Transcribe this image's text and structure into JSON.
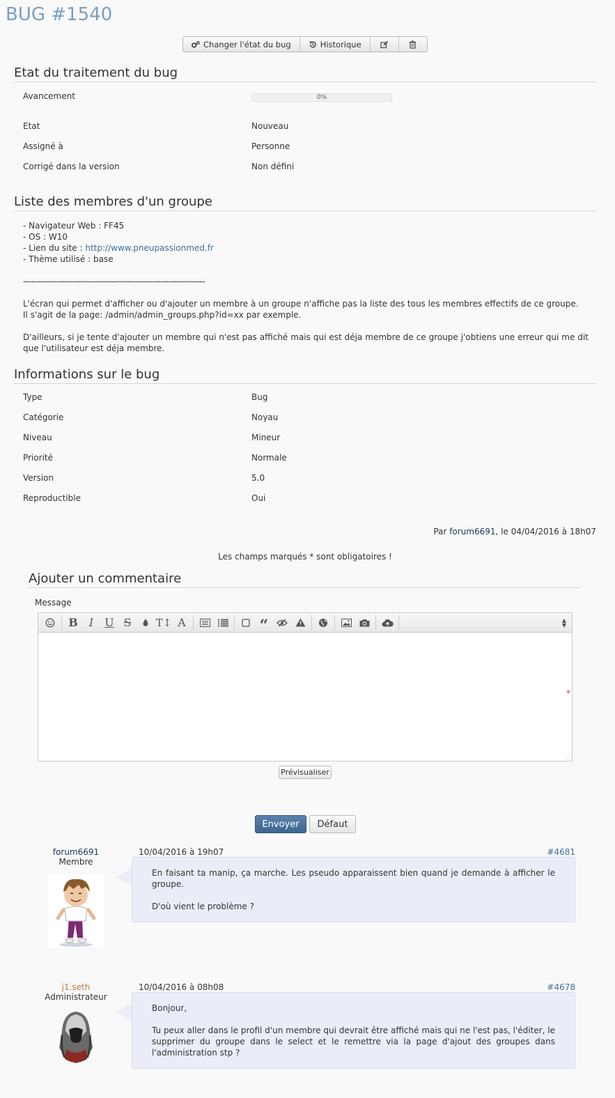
{
  "page": {
    "title": "BUG #1540"
  },
  "toolbar": {
    "change_state": "Changer l'état du bug",
    "history": "Historique"
  },
  "status_section": {
    "title": "Etat du traitement du bug",
    "progress_label": "Avancement",
    "progress_text": "0%",
    "progress_value": 0,
    "rows": [
      {
        "label": "Etat",
        "value": "Nouveau"
      },
      {
        "label": "Assigné à",
        "value": "Personne"
      },
      {
        "label": "Corrigé dans la version",
        "value": "Non défini"
      }
    ]
  },
  "description": {
    "title": "Liste des membres d'un groupe",
    "browser": "- Navigateur Web : FF45",
    "os": "- OS : W10",
    "site_prefix": "- Lien du site : ",
    "site_link": "http://www.pneupassionmed.fr",
    "theme": "- Thème utilisé : base",
    "separator": "----------------------------------------------------------------------",
    "para1_line1": "L'écran qui permet d'afficher ou d'ajouter un membre à un groupe n'affiche pas la liste des tous les membres effectifs de ce groupe.",
    "para1_line2": "Il s'agit de la page: /admin/admin_groups.php?id=xx par exemple.",
    "para2": "D'ailleurs, si je tente d'ajouter un membre qui n'est pas affiché mais qui est déja membre de ce groupe j'obtiens une erreur qui me dit que l'utilisateur est déja membre."
  },
  "info_section": {
    "title": "Informations sur le bug",
    "rows": [
      {
        "label": "Type",
        "value": "Bug"
      },
      {
        "label": "Catégorie",
        "value": "Noyau"
      },
      {
        "label": "Niveau",
        "value": "Mineur"
      },
      {
        "label": "Priorité",
        "value": "Normale"
      },
      {
        "label": "Version",
        "value": "5.0"
      },
      {
        "label": "Reproductible",
        "value": "Oui"
      }
    ]
  },
  "byline": {
    "prefix": "Par ",
    "author": "forum6691",
    "suffix": ", le 04/04/2016 à 18h07"
  },
  "form": {
    "required_note": "Les champs marqués * sont obligatoires !",
    "title": "Ajouter un commentaire",
    "message_label": "Message",
    "required_star": "*",
    "preview": "Prévisualiser",
    "submit": "Envoyer",
    "default": "Défaut"
  },
  "comments": [
    {
      "author": "forum6691",
      "rank": "Membre",
      "date": "10/04/2016 à 19h07",
      "ref": "#4681",
      "p1": "En faisant ta manip, ça marche. Les pseudo apparaissent bien quand je demande à afficher le groupe.",
      "p2": "D'où vient le problème ?"
    },
    {
      "author": "j1.seth",
      "rank": "Administrateur",
      "date": "10/04/2016 à 08h08",
      "ref": "#4678",
      "p1": "Bonjour,",
      "p2": "Tu peux aller dans le profil d'un membre qui devrait être affiché mais qui ne l'est pas, l'éditer, le supprimer du groupe dans le select et le remettre via la page d'ajout des groupes dans l'adminis­tration stp ?"
    }
  ],
  "colors": {
    "title": "#7a9ec0",
    "primary_button": "#3d6592",
    "bubble": "#eaedf8",
    "admin_name": "#c87a3c"
  }
}
